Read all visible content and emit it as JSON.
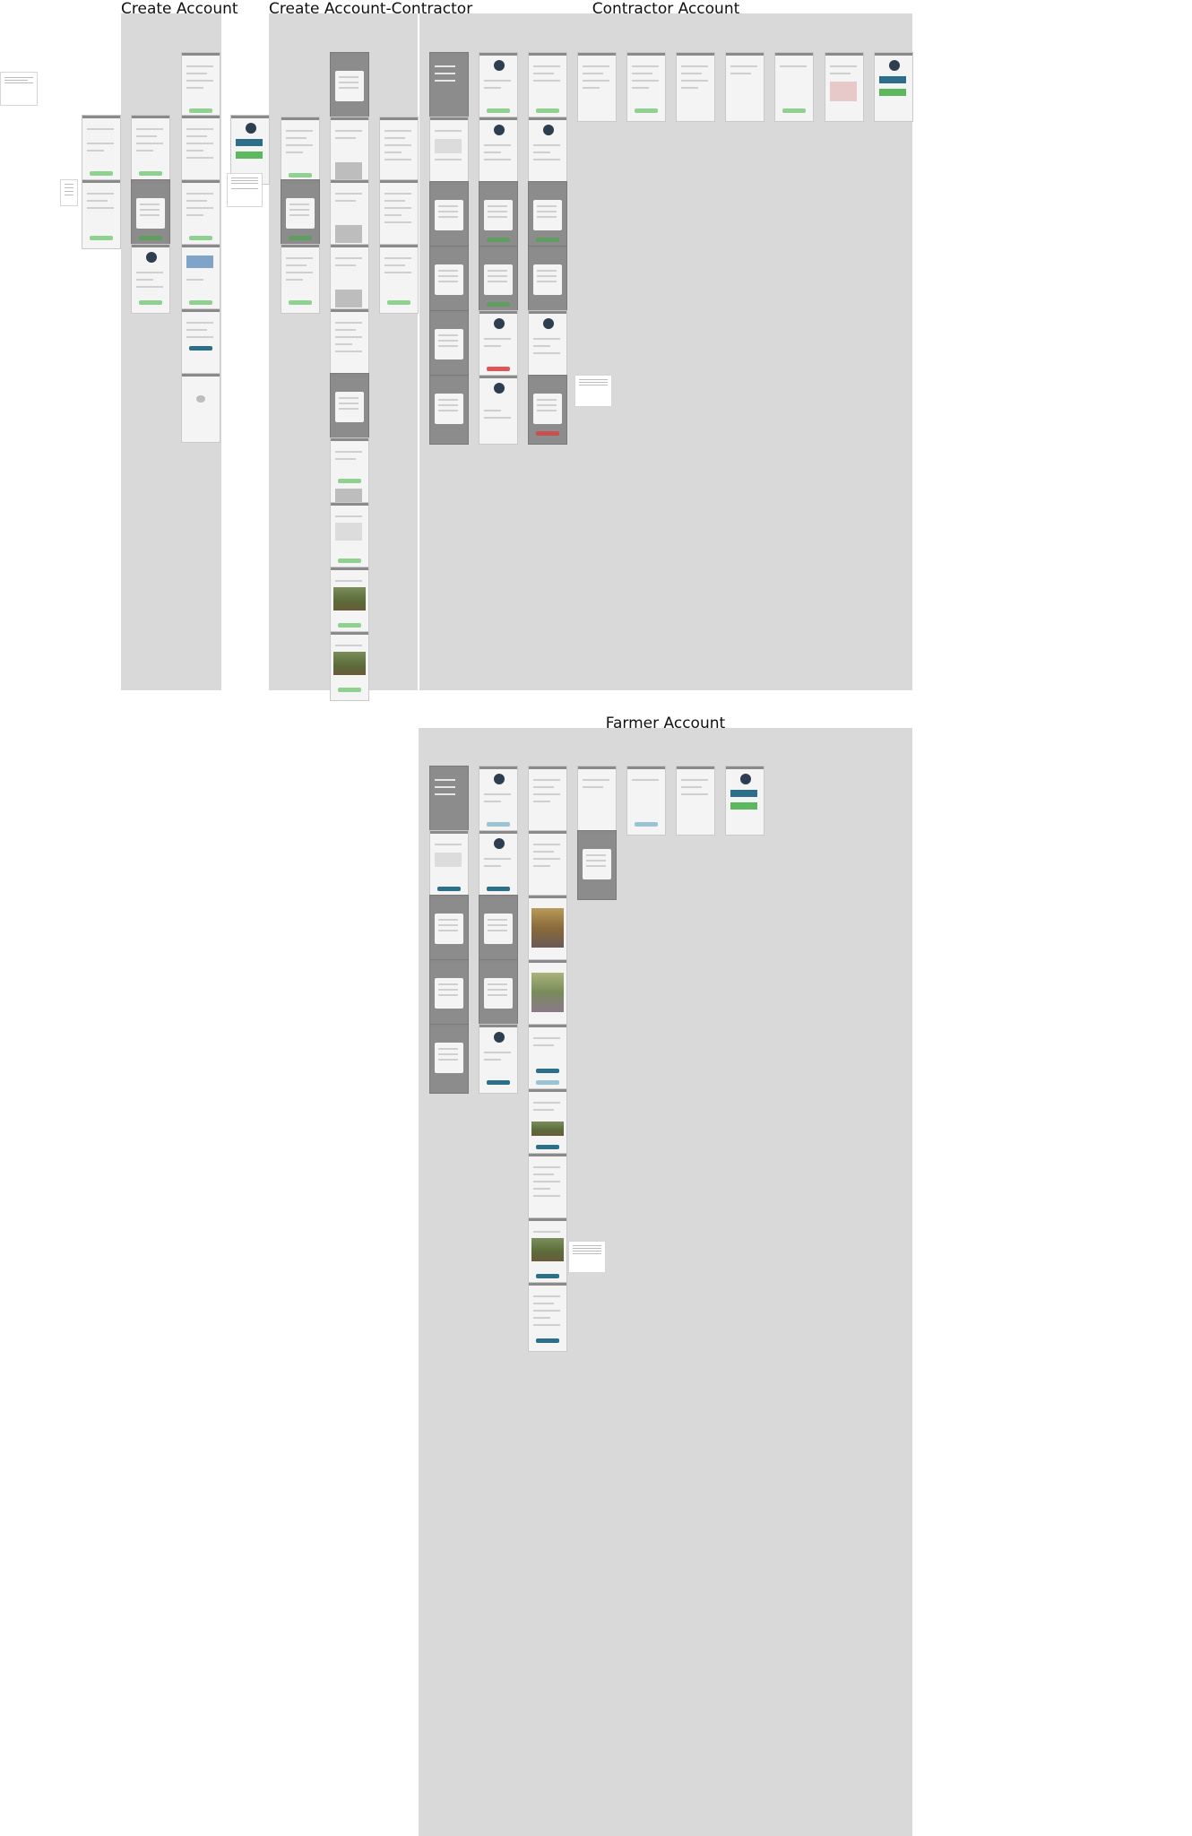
{
  "sections": [
    {
      "title": "Create Account"
    },
    {
      "title": "Create Account-Contractor"
    },
    {
      "title": "Contractor Account"
    },
    {
      "title": "Farmer Account"
    }
  ]
}
